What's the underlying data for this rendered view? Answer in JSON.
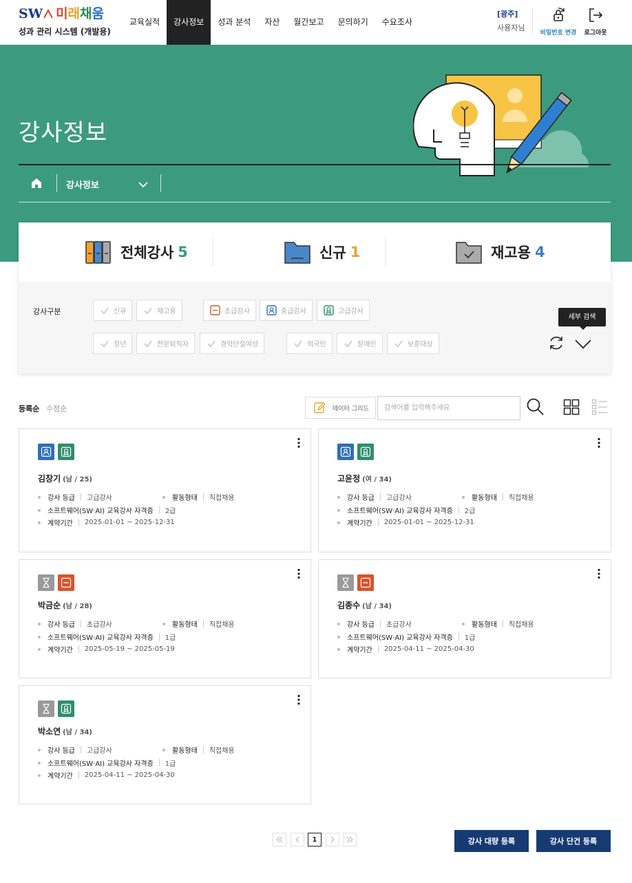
{
  "header": {
    "brand_sw": "SW",
    "brand_ko": [
      "미",
      "래",
      "채",
      "움"
    ],
    "system_name": "성과 관리 시스템 (개발용)",
    "nav": [
      "교육실적",
      "강사정보",
      "성과 분석",
      "자산",
      "월간보고",
      "문의하기",
      "수요조사"
    ],
    "active_nav": "강사정보",
    "region": "[광주]",
    "role": "사용자님",
    "password_change": "비밀번호 변경",
    "logout": "로그아웃"
  },
  "hero": {
    "title": "강사정보",
    "breadcrumb_select": "강사정보"
  },
  "stats": [
    {
      "label": "전체강사",
      "count": "5"
    },
    {
      "label": "신규",
      "count": "1"
    },
    {
      "label": "재고용",
      "count": "4"
    }
  ],
  "filters": {
    "label": "강사구분",
    "row1_group1": [
      "신규",
      "재고용"
    ],
    "row1_group2": [
      "초급강사",
      "중급강사",
      "고급강사"
    ],
    "row2_group1": [
      "청년",
      "전문퇴직자",
      "경력단절여성"
    ],
    "row2_group2": [
      "외국인",
      "장애인",
      "보훈대상"
    ],
    "tooltip": "세부 검색"
  },
  "toolbar": {
    "sort_register": "등록순",
    "sort_modified": "수정순",
    "data_grid": "데이터 그리드",
    "search_placeholder": "검색어를 입력해주세요"
  },
  "field_labels": {
    "grade": "강사 등급",
    "activity": "활동형태",
    "cert": "소프트웨어(SW·AI) 교육강사 자격증",
    "period": "계약기간"
  },
  "colors": {
    "brand_green": "#3c9b7e",
    "navy": "#163b73",
    "beginner_badge": "#d9542b",
    "intermediate_badge": "#2f6fb9",
    "advanced_badge": "#2e8f6b",
    "pending_badge": "#9a9a9a"
  },
  "instructors": [
    {
      "name": "김창기",
      "meta": "(남 / 25)",
      "badges": [
        "person-icon",
        "advanced-icon"
      ],
      "grade": "고급강사",
      "activity": "직접채용",
      "cert": "2급",
      "period": "2025-01-01 ~ 2025-12-31"
    },
    {
      "name": "고윤정",
      "meta": "(여 / 34)",
      "badges": [
        "person-icon",
        "advanced-icon"
      ],
      "grade": "고급강사",
      "activity": "직접채용",
      "cert": "2급",
      "period": "2025-01-01 ~ 2025-12-31"
    },
    {
      "name": "박금순",
      "meta": "(남 / 28)",
      "badges": [
        "hourglass-icon",
        "beginner-icon"
      ],
      "grade": "초급강사",
      "activity": "직접채용",
      "cert": "1급",
      "period": "2025-05-19 ~ 2025-05-19"
    },
    {
      "name": "김종수",
      "meta": "(남 / 34)",
      "badges": [
        "hourglass-icon",
        "beginner-icon"
      ],
      "grade": "초급강사",
      "activity": "직접채용",
      "cert": "1급",
      "period": "2025-04-11 ~ 2025-04-30"
    },
    {
      "name": "박소연",
      "meta": "(남 / 34)",
      "badges": [
        "hourglass-icon",
        "advanced-icon"
      ],
      "grade": "고급강사",
      "activity": "직접채용",
      "cert": "1급",
      "period": "2025-04-11 ~ 2025-04-30"
    }
  ],
  "pagination": {
    "current": "1"
  },
  "actions": {
    "bulk_register": "강사 대량 등록",
    "single_register": "강사 단건 등록"
  }
}
